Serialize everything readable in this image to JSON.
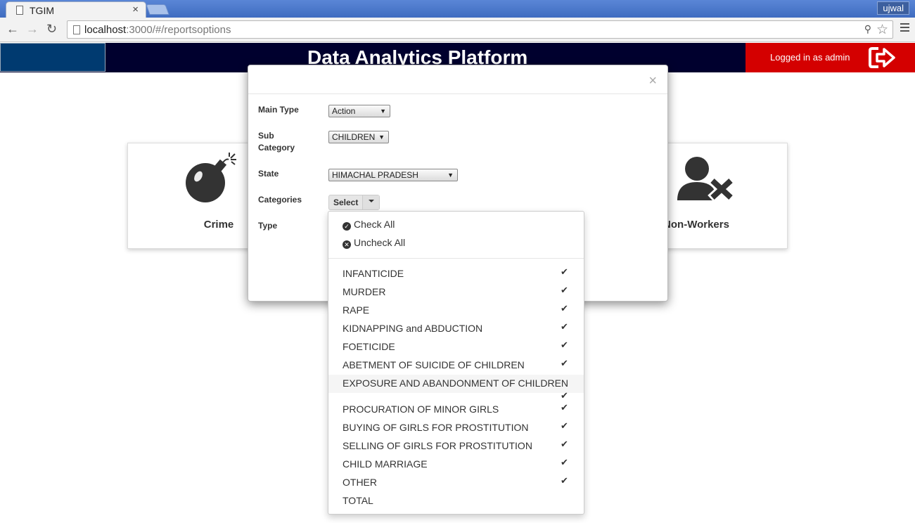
{
  "browser": {
    "tab_title": "TGIM",
    "tab_close": "×",
    "user": "ujwal",
    "url_host": "localhost",
    "url_rest": ":3000/#/reportsoptions"
  },
  "header": {
    "title": "Data Analytics Platform",
    "login_text": "Logged in as admin"
  },
  "cards": [
    {
      "label": "Crime",
      "icon": "bomb-icon"
    },
    {
      "label": "Non-Workers",
      "icon": "user-remove-icon"
    }
  ],
  "modal": {
    "close": "×",
    "main_type": {
      "label": "Main Type",
      "value": "Action"
    },
    "sub_category": {
      "label_line1": "Sub",
      "label_line2": "Category",
      "value": "CHILDREN"
    },
    "state": {
      "label": "State",
      "value": "HIMACHAL PRADESH"
    },
    "categories": {
      "label": "Categories",
      "button": "Select"
    },
    "type": {
      "label": "Type"
    }
  },
  "dropdown": {
    "check_all": "Check All",
    "uncheck_all": "Uncheck All",
    "items": [
      {
        "label": "INFANTICIDE",
        "checked": true
      },
      {
        "label": "MURDER",
        "checked": true
      },
      {
        "label": "RAPE",
        "checked": true
      },
      {
        "label": "KIDNAPPING and ABDUCTION",
        "checked": true
      },
      {
        "label": "FOETICIDE",
        "checked": true
      },
      {
        "label": "ABETMENT OF SUICIDE OF CHILDREN",
        "checked": true
      },
      {
        "label": "EXPOSURE AND ABANDONMENT OF CHILDREN",
        "checked": true
      },
      {
        "label": "PROCURATION OF MINOR GIRLS",
        "checked": true
      },
      {
        "label": "BUYING OF GIRLS FOR PROSTITUTION",
        "checked": true
      },
      {
        "label": "SELLING OF GIRLS FOR PROSTITUTION",
        "checked": true
      },
      {
        "label": "CHILD MARRIAGE",
        "checked": true
      },
      {
        "label": "OTHER",
        "checked": true
      },
      {
        "label": "TOTAL",
        "checked": false
      }
    ]
  }
}
